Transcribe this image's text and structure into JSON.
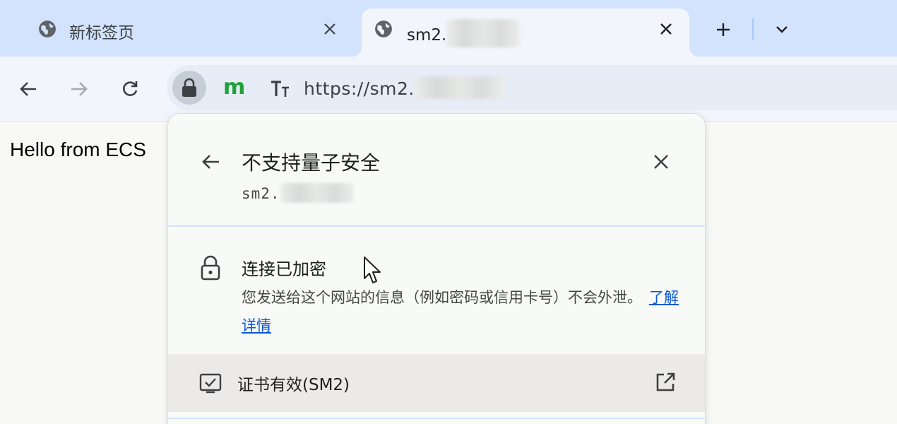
{
  "tabs": [
    {
      "title": "新标签页",
      "active": false,
      "icon": "globe-icon"
    },
    {
      "title": "sm2.",
      "active": true,
      "icon": "globe-icon"
    }
  ],
  "tabstrip": {
    "new_tab_icon": "plus-icon",
    "tab_search_icon": "chevron-down-icon"
  },
  "toolbar": {
    "back_icon": "arrow-left-icon",
    "forward_icon": "arrow-right-icon",
    "reload_icon": "reload-icon",
    "site_info_icon": "lock-icon",
    "extension_m": "m",
    "extension_t_icon": "text-size-icon",
    "url": "https://sm2."
  },
  "page": {
    "text": "Hello from ECS"
  },
  "popup": {
    "title": "不支持量子安全",
    "host": "sm2.",
    "connection_title": "连接已加密",
    "connection_desc": "您发送给这个网站的信息（例如密码或信用卡号）不会外泄。",
    "learn_more": "了解详情",
    "certificate_label": "证书有效(SM2)"
  },
  "colors": {
    "tabstrip_bg": "#d3e3fd",
    "toolbar_bg": "#f2f6fc",
    "link": "#0b57d0",
    "extension_green": "#21a039"
  }
}
